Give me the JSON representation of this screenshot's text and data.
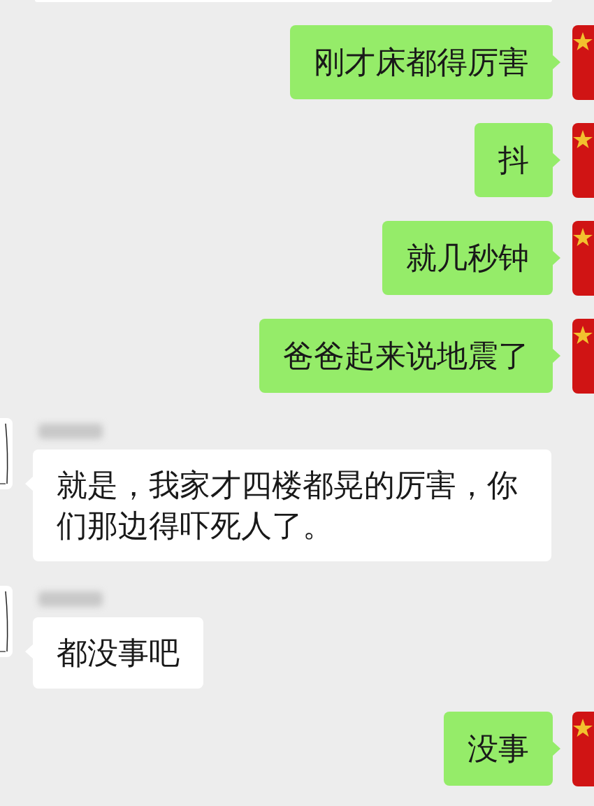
{
  "messages": [
    {
      "kind": "sent",
      "text": "刚才床都得厉害"
    },
    {
      "kind": "sent",
      "text": "抖"
    },
    {
      "kind": "sent",
      "text": "就几秒钟"
    },
    {
      "kind": "sent",
      "text": "爸爸起来说地震了"
    },
    {
      "kind": "received",
      "text": "就是，我家才四楼都晃的厉害，你们那边得吓死人了。"
    },
    {
      "kind": "received",
      "text": "都没事吧"
    },
    {
      "kind": "sent",
      "text": "没事"
    }
  ]
}
